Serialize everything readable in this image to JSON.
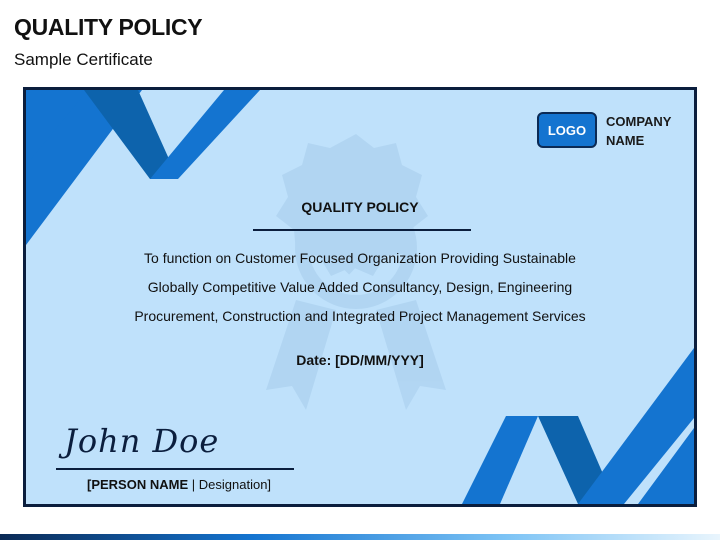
{
  "header": {
    "title": "QUALITY POLICY",
    "subtitle": "Sample Certificate"
  },
  "certificate": {
    "logo_label": "LOGO",
    "company_name_line1": "COMPANY",
    "company_name_line2": "NAME",
    "title": "QUALITY POLICY",
    "policy_lines": [
      "To function on Customer Focused Organization Providing Sustainable",
      "Globally Competitive Value Added Consultancy, Design, Engineering",
      "Procurement, Construction and Integrated Project Management Services"
    ],
    "date_label": "Date: [DD/MM/YYY]",
    "signature": "John Doe",
    "person_name": "[PERSON NAME",
    "separator": "|",
    "designation": "Designation]"
  },
  "colors": {
    "background": "#bfe1fb",
    "ribbon_dark": "#0d63ac",
    "ribbon_main": "#1474d0",
    "border": "#0b1e3d"
  },
  "icons": {
    "watermark": "quality-badge-ribbon-icon"
  }
}
